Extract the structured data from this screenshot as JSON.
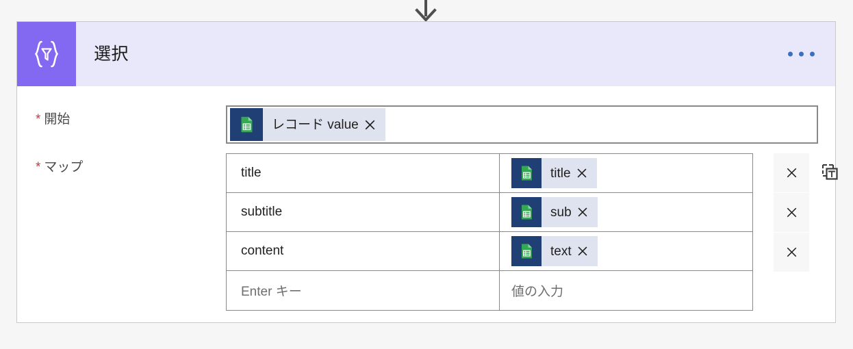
{
  "connector": {
    "arrow_icon": "arrow-down-icon"
  },
  "card": {
    "icon": "select-braces-filter-icon",
    "title": "選択",
    "menu_label": "・・・",
    "accent_color": "#8368f2",
    "header_color": "#e9e8fa",
    "menu_dot_color": "#3a6fc4"
  },
  "fields": {
    "from": {
      "label": "開始",
      "required_mark": "*",
      "token": {
        "icon": "google-sheets-icon",
        "text": "レコード value",
        "remove_icon": "close-icon"
      }
    },
    "map": {
      "label": "マップ",
      "required_mark": "*",
      "text_mode_icon": "switch-to-text-mode-icon",
      "rows": [
        {
          "key": "title",
          "value_token": {
            "icon": "google-sheets-icon",
            "text": "title",
            "remove_icon": "close-icon"
          },
          "delete_icon": "close-icon"
        },
        {
          "key": "subtitle",
          "value_token": {
            "icon": "google-sheets-icon",
            "text": "sub",
            "remove_icon": "close-icon"
          },
          "delete_icon": "close-icon"
        },
        {
          "key": "content",
          "value_token": {
            "icon": "google-sheets-icon",
            "text": "text",
            "remove_icon": "close-icon"
          },
          "delete_icon": "close-icon"
        }
      ],
      "new_row": {
        "key_placeholder": "Enter キー",
        "value_placeholder": "値の入力"
      }
    }
  },
  "colors": {
    "required_star": "#d13438",
    "token_background": "#dfe3ef",
    "token_icon_background": "#1f3f75",
    "sheets_green": "#34a853",
    "border": "#8a8886",
    "page_background": "#f6f6f6"
  }
}
